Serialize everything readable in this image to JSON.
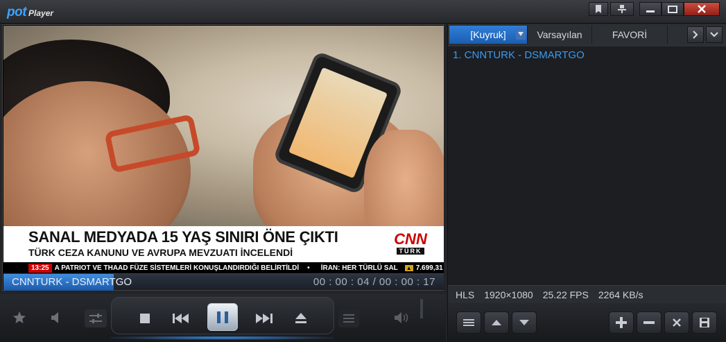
{
  "titlebar": {
    "logo_pot": "pot",
    "logo_player": "Player"
  },
  "video": {
    "headline": "SANAL MEDYADA 15 YAŞ SINIRI ÖNE ÇIKTI",
    "subhead": "TÜRK CEZA KANUNU VE AVRUPA MEVZUATI İNCELENDİ",
    "channel_logo_top": "CNN",
    "channel_logo_bottom": "TÜRK",
    "ticker_time": "13:25",
    "ticker_text": "A PATRIOT VE THAAD FÜZE SİSTEMLERİ KONUŞLANDIRDIĞI BELİRTİLDİ",
    "ticker_text2": "İRAN: HER TÜRLÜ SAL",
    "ticker_value": "7.699,31"
  },
  "osd": {
    "title": "CNNTURK - DSMARTGO",
    "time": "00 : 00 : 04 / 00 : 00 : 17",
    "progress": 0.25
  },
  "playlist": {
    "tabs": [
      {
        "label": "[Kuyruk]"
      },
      {
        "label": "Varsayılan"
      },
      {
        "label": "FAVORİ"
      }
    ],
    "items": [
      {
        "label": "1. CNNTURK - DSMARTGO"
      }
    ],
    "status": {
      "protocol": "HLS",
      "resolution": "1920×1080",
      "fps": "25.22 FPS",
      "bitrate": "2264 KB/s"
    }
  },
  "colors": {
    "accent": "#2f7fd8",
    "playlist_text": "#3a9bf0",
    "close": "#c43a2e"
  }
}
